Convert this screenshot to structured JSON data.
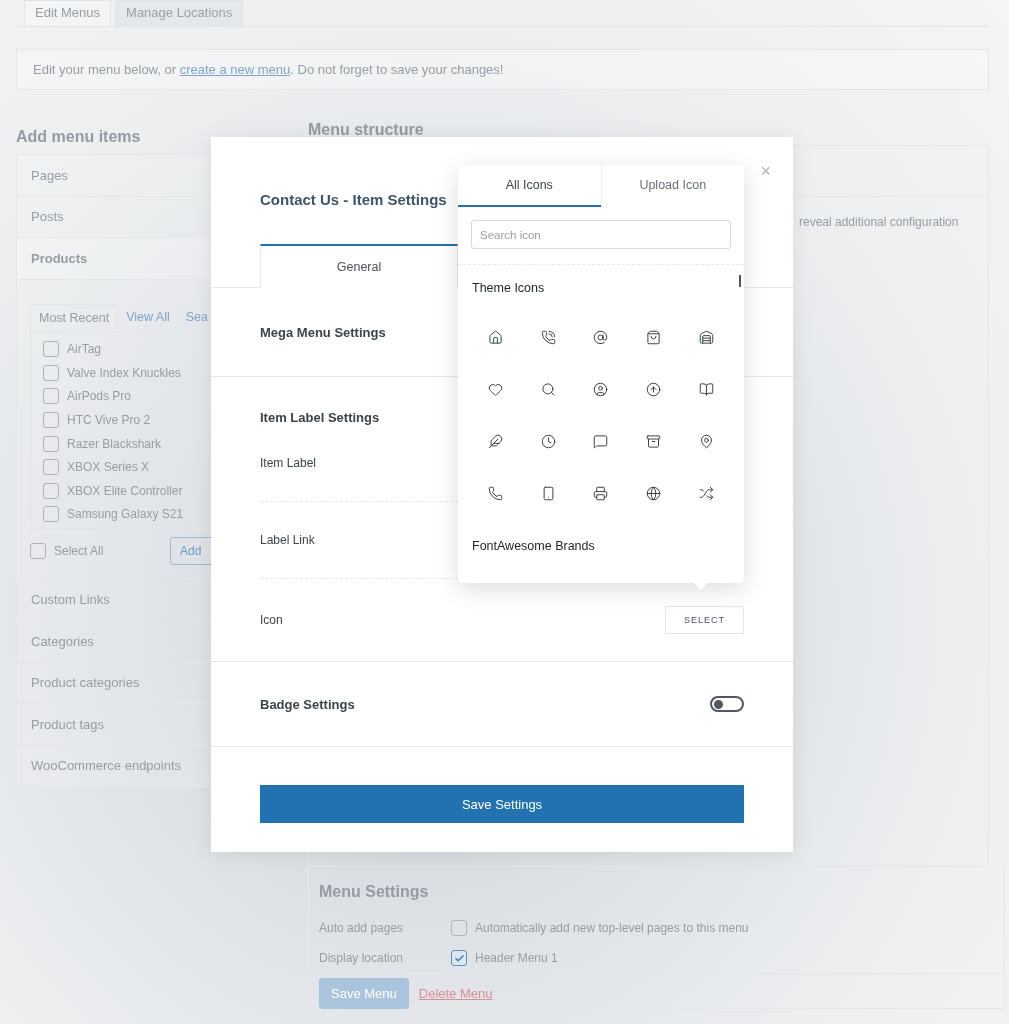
{
  "tabs": [
    {
      "label": "Edit Menus",
      "selected": true
    },
    {
      "label": "Manage Locations",
      "selected": false
    }
  ],
  "notice": {
    "before": "Edit your menu below, or ",
    "link": "create a new menu",
    "after": ". Do not forget to save your changes!"
  },
  "add_menu_items": {
    "title": "Add menu items",
    "sections": [
      {
        "label": "Pages",
        "expanded": false
      },
      {
        "label": "Posts",
        "expanded": false
      },
      {
        "label": "Products",
        "expanded": true
      },
      {
        "label": "Custom Links",
        "expanded": false
      },
      {
        "label": "Categories",
        "expanded": false
      },
      {
        "label": "Product categories",
        "expanded": false
      },
      {
        "label": "Product tags",
        "expanded": false
      },
      {
        "label": "WooCommerce endpoints",
        "expanded": false
      }
    ],
    "products_panel": {
      "tabs": [
        {
          "label": "Most Recent",
          "selected": true
        },
        {
          "label": "View All",
          "selected": false
        },
        {
          "label": "Sea",
          "selected": false
        }
      ],
      "items": [
        {
          "label": "AirTag",
          "checked": false
        },
        {
          "label": "Valve Index Knuckles",
          "checked": false
        },
        {
          "label": "AirPods Pro",
          "checked": false
        },
        {
          "label": "HTC Vive Pro 2",
          "checked": false
        },
        {
          "label": "Razer Blackshark",
          "checked": false
        },
        {
          "label": "XBOX Series X",
          "checked": false
        },
        {
          "label": "XBOX Elite Controller",
          "checked": false
        },
        {
          "label": "Samsung Galaxy S21",
          "checked": false
        }
      ],
      "select_all": {
        "label": "Select All",
        "checked": false
      },
      "add_button": "Add"
    }
  },
  "menu_structure": {
    "title": "Menu structure",
    "hint": "reveal additional configuration"
  },
  "menu_settings": {
    "title": "Menu Settings",
    "rows": [
      {
        "label": "Auto add pages",
        "option": "Automatically add new top-level pages to this menu",
        "checked": false
      },
      {
        "label": "Display location",
        "option": "Header Menu 1",
        "checked": true
      }
    ],
    "save_button": "Save Menu",
    "delete_link": "Delete Menu"
  },
  "modal": {
    "title": "Contact Us - Item Settings",
    "close": "×",
    "tabs": [
      {
        "label": "General",
        "selected": true
      }
    ],
    "mega_menu": {
      "title": "Mega Menu Settings"
    },
    "item_label": {
      "title": "Item Label Settings",
      "fields": [
        {
          "label": "Item Label",
          "kind": "blank"
        },
        {
          "label": "Label Link",
          "kind": "blank"
        },
        {
          "label": "Icon",
          "kind": "select",
          "button": "SELECT"
        }
      ]
    },
    "badge": {
      "title": "Badge Settings",
      "on": false
    },
    "save_button": "Save Settings"
  },
  "icon_picker": {
    "tabs": [
      {
        "label": "All Icons",
        "selected": true
      },
      {
        "label": "Upload Icon",
        "selected": false
      }
    ],
    "search": {
      "placeholder": "Search icon"
    },
    "groups": [
      {
        "title": "Theme Icons",
        "kind": "grid"
      },
      {
        "title": "FontAwesome Brands",
        "kind": "heading"
      }
    ]
  }
}
